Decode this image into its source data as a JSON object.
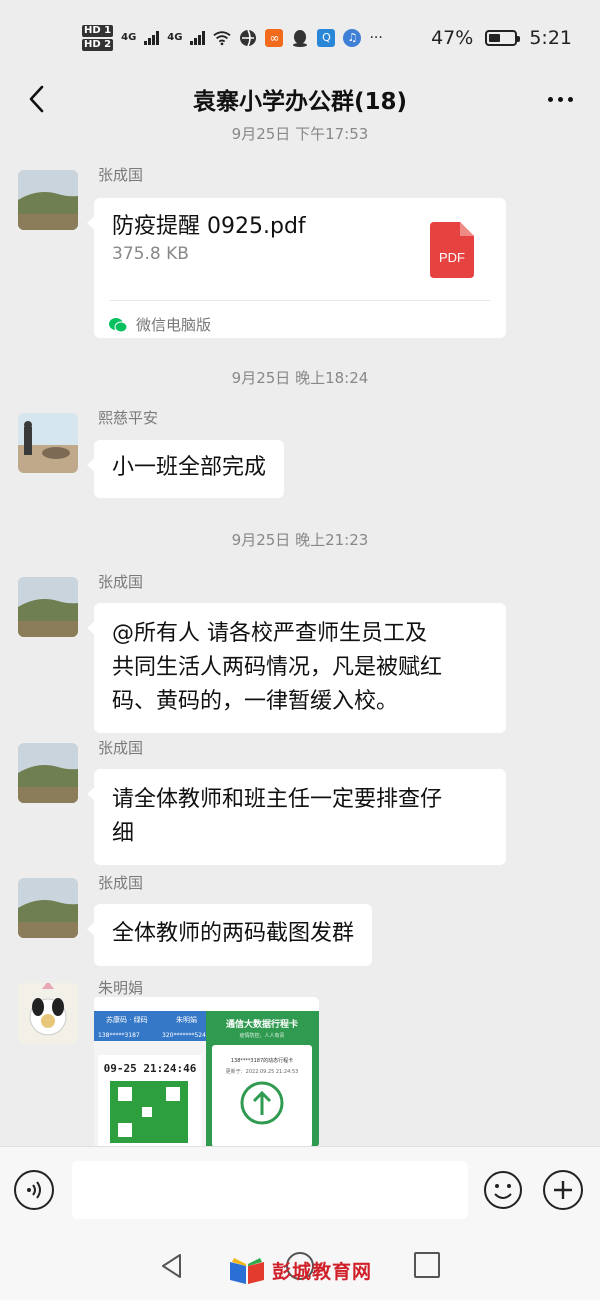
{
  "status_bar": {
    "hd_top": "HD 1",
    "hd_bottom": "HD 2",
    "net1": "4G",
    "net2": "4G",
    "more": "···",
    "battery_text": "47%",
    "battery_level": 0.47,
    "time": "5:21"
  },
  "header": {
    "title": "袁寨小学办公群(18)"
  },
  "chat": {
    "top_timestamp": "9月25日 下午17:53",
    "messages": [
      {
        "sender": "张成国",
        "file": {
          "name": "防疫提醒 0925.pdf",
          "size": "375.8 KB",
          "badge": "PDF",
          "source": "微信电脑版"
        }
      },
      {
        "timestamp": "9月25日 晚上18:24"
      },
      {
        "sender": "熙慈平安",
        "text": "小一班全部完成"
      },
      {
        "timestamp": "9月25日 晚上21:23"
      },
      {
        "sender": "张成国",
        "text_lines": [
          "@所有人  请各校严查师生员工及",
          "共同生活人两码情况，凡是被赋红",
          "码、黄码的，一律暂缓入校。"
        ]
      },
      {
        "sender": "张成国",
        "text_lines": [
          "请全体教师和班主任一定要排查仔",
          "细"
        ]
      },
      {
        "sender": "张成国",
        "text": "全体教师的两码截图发群"
      },
      {
        "sender": "朱明娟",
        "image": {
          "left_title": "苏康码 · 绿码",
          "left_name": "朱明娟",
          "left_phone": "138*****3187",
          "left_id": "320*******524",
          "left_time": "09-25 21:24:46",
          "right_title": "通信大数据行程卡",
          "right_sub": "疫情防控，人人有责",
          "right_phone": "138****3187的动态行程卡",
          "right_update": "更新于：2022.09.25 21:24:53"
        }
      }
    ]
  },
  "input_bar": {
    "placeholder": ""
  },
  "watermark": {
    "text": "彭城教育网"
  },
  "colors": {
    "background": "#ededed",
    "bubble": "#ffffff",
    "pdf_red": "#e64340",
    "wechat_green": "#07c160",
    "watermark_red": "#d0202a"
  }
}
